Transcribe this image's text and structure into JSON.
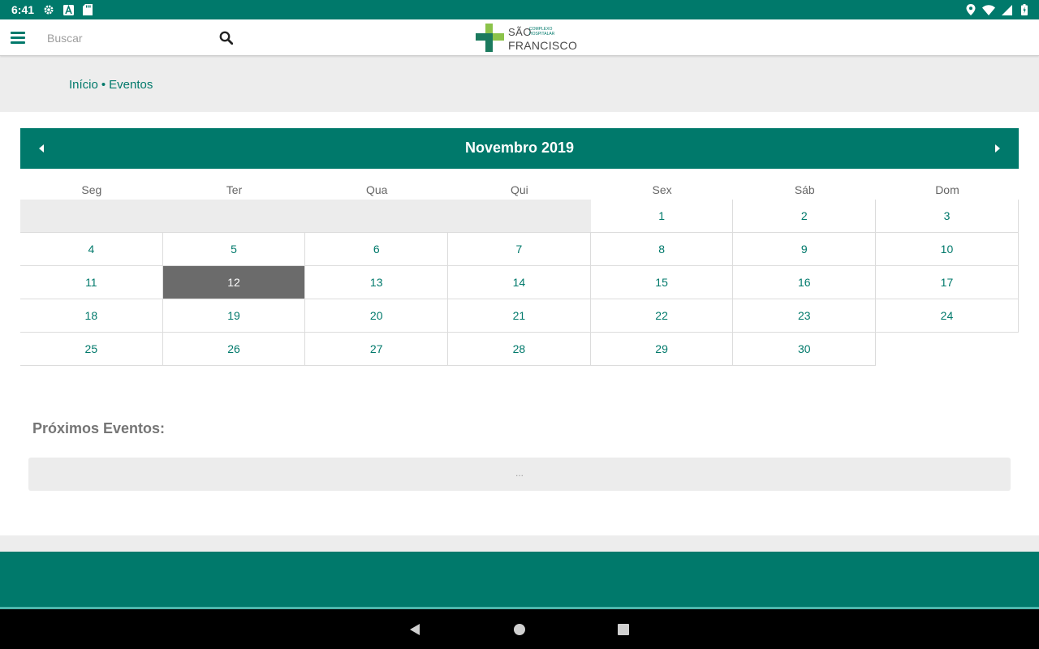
{
  "status_bar": {
    "time": "6:41",
    "left_icons": [
      "gear-icon",
      "a-letter-icon",
      "sd-card-icon"
    ],
    "right_icons": [
      "location-icon",
      "wifi-icon",
      "signal-icon",
      "battery-icon"
    ]
  },
  "app_bar": {
    "search_placeholder": "Buscar",
    "logo": {
      "line1": "SÃO",
      "sub1": "COMPLEXO",
      "sub2": "HOSPITALAR",
      "line2": "FRANCISCO"
    }
  },
  "breadcrumb": {
    "home": "Início",
    "separator": "•",
    "current": "Eventos"
  },
  "calendar": {
    "month_title": "Novembro 2019",
    "weekdays": [
      "Seg",
      "Ter",
      "Qua",
      "Qui",
      "Sex",
      "Sáb",
      "Dom"
    ],
    "weeks": [
      [
        "",
        "",
        "",
        "",
        "1",
        "2",
        "3"
      ],
      [
        "4",
        "5",
        "6",
        "7",
        "8",
        "9",
        "10"
      ],
      [
        "11",
        "12",
        "13",
        "14",
        "15",
        "16",
        "17"
      ],
      [
        "18",
        "19",
        "20",
        "21",
        "22",
        "23",
        "24"
      ],
      [
        "25",
        "26",
        "27",
        "28",
        "29",
        "30",
        ""
      ]
    ],
    "selected_day": "12"
  },
  "upcoming": {
    "title": "Próximos Eventos:",
    "placeholder": "..."
  },
  "colors": {
    "primary": "#00796b",
    "selected_day": "#6b6b6b",
    "logo_dark_green": "#1b7a5e",
    "logo_light_green": "#8bc34a"
  }
}
